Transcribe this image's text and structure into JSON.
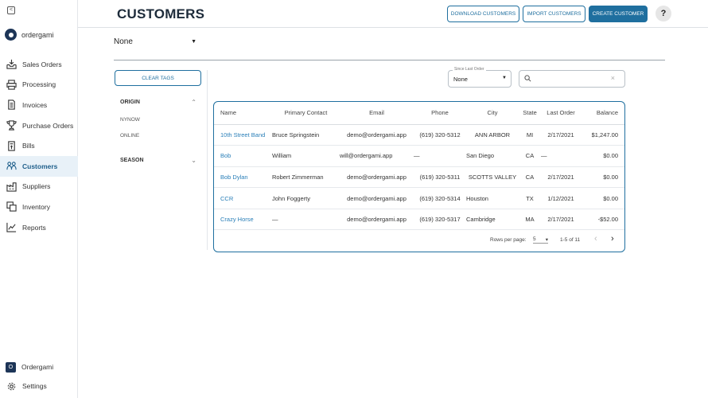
{
  "brand": {
    "name": "ordergami"
  },
  "nav": [
    {
      "label": "Sales Orders",
      "icon": "inbox-tray-icon"
    },
    {
      "label": "Processing",
      "icon": "printer-icon"
    },
    {
      "label": "Invoices",
      "icon": "document-icon"
    },
    {
      "label": "Purchase Orders",
      "icon": "trophy-icon"
    },
    {
      "label": "Bills",
      "icon": "receipt-icon"
    },
    {
      "label": "Customers",
      "icon": "people-icon",
      "active": true
    },
    {
      "label": "Suppliers",
      "icon": "factory-icon"
    },
    {
      "label": "Inventory",
      "icon": "boxes-icon"
    },
    {
      "label": "Reports",
      "icon": "line-chart-icon"
    }
  ],
  "sidebar_bottom": {
    "org_badge": "O",
    "org_name": "Ordergami",
    "settings": "Settings"
  },
  "header": {
    "title": "CUSTOMERS",
    "download": "DOWNLOAD CUSTOMERS",
    "import": "IMPORT CUSTOMERS",
    "create": "CREATE CUSTOMER",
    "help": "?"
  },
  "filter": {
    "value": "None"
  },
  "tags": {
    "clear": "CLEAR TAGS",
    "origin": {
      "label": "ORIGIN",
      "options": [
        "NYNOW",
        "ONLINE"
      ]
    },
    "season": {
      "label": "SEASON"
    }
  },
  "since_last_order": {
    "label": "Since Last Order",
    "value": "None"
  },
  "search": {
    "placeholder": "",
    "value": ""
  },
  "table": {
    "columns": [
      "Name",
      "Primary Contact",
      "Email",
      "Phone",
      "City",
      "State",
      "Last Order",
      "Balance"
    ],
    "rows": [
      [
        "10th Street Band",
        "Bruce Springstein",
        "demo@ordergami.app",
        "(619) 320-5312",
        "ANN ARBOR",
        "MI",
        "2/17/2021",
        "$1,247.00"
      ],
      [
        "Bob",
        "William",
        "will@ordergami.app",
        "—",
        "San Diego",
        "CA",
        "—",
        "$0.00"
      ],
      [
        "Bob Dylan",
        "Robert Zimmerman",
        "demo@ordergami.app",
        "(619) 320-5311",
        "SCOTTS VALLEY",
        "CA",
        "2/17/2021",
        "$0.00"
      ],
      [
        "CCR",
        "John Foggerty",
        "demo@ordergami.app",
        "(619) 320-5314",
        "Houston",
        "TX",
        "1/12/2021",
        "$0.00"
      ],
      [
        "Crazy Horse",
        "—",
        "demo@ordergami.app",
        "(619) 320-5317",
        "Cambridge",
        "MA",
        "2/17/2021",
        "-$52.00"
      ]
    ]
  },
  "pager": {
    "rows_label": "Rows per page:",
    "rows_value": "5",
    "range": "1-5 of 11"
  }
}
